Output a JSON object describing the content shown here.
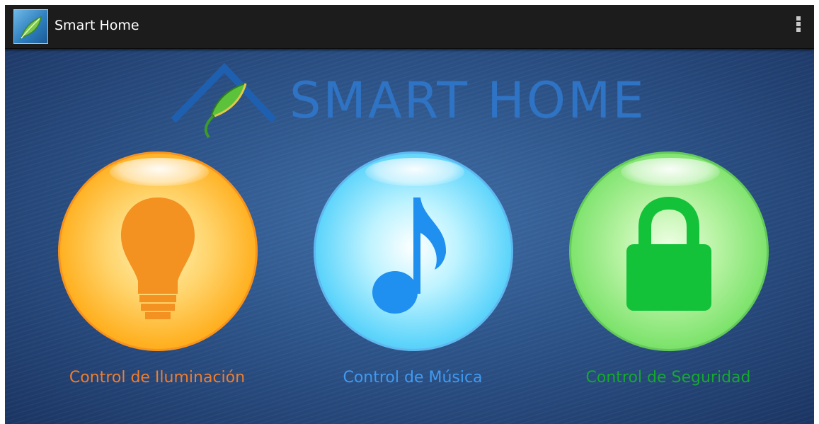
{
  "action_bar": {
    "app_icon": "smart-home-leaf-icon",
    "title": "Smart Home",
    "overflow_icon": "overflow-menu-icon"
  },
  "logo": {
    "text": "SMART HOME",
    "icon": "house-roof-leaf-icon",
    "color": "#2f73c4"
  },
  "controls": [
    {
      "label": "Control de Iluminación",
      "icon": "lightbulb-icon",
      "color": "#f07d2c"
    },
    {
      "label": "Control de Música",
      "icon": "music-note-icon",
      "color": "#3f9af0"
    },
    {
      "label": "Control de Seguridad",
      "icon": "padlock-icon",
      "color": "#15a92d"
    }
  ]
}
